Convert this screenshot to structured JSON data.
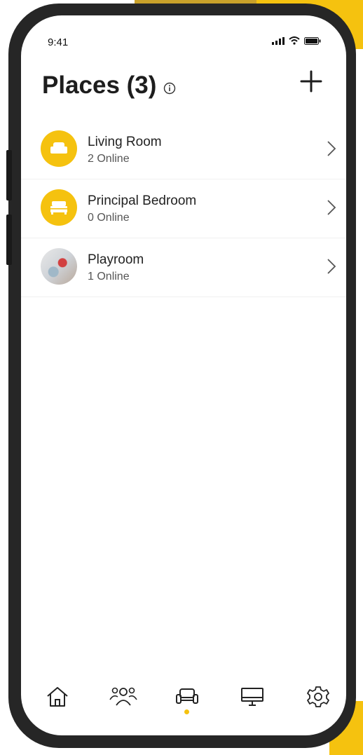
{
  "status_bar": {
    "time": "9:41"
  },
  "header": {
    "title": "Places (3)"
  },
  "places": [
    {
      "name": "Living Room",
      "status": "2 Online",
      "icon": "sofa-icon"
    },
    {
      "name": "Principal Bedroom",
      "status": "0 Online",
      "icon": "bed-icon"
    },
    {
      "name": "Playroom",
      "status": "1 Online",
      "icon": "photo"
    }
  ],
  "tabs": [
    {
      "icon": "home-icon"
    },
    {
      "icon": "people-icon"
    },
    {
      "icon": "sofa-icon",
      "active": true
    },
    {
      "icon": "monitor-icon"
    },
    {
      "icon": "gear-icon"
    }
  ],
  "colors": {
    "accent": "#f5c20f",
    "frame": "#262626",
    "text": "#1d1d1d"
  }
}
